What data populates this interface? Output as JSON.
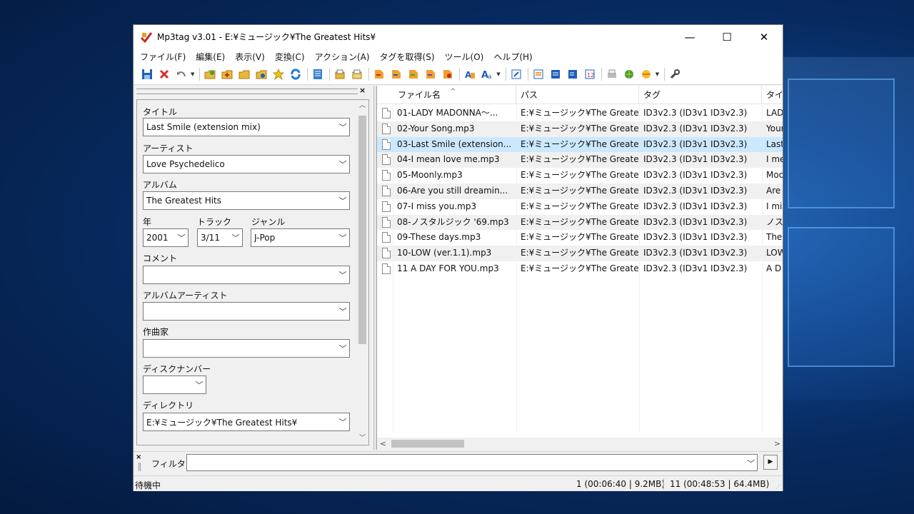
{
  "window": {
    "title": "Mp3tag v3.01  -  E:¥ミュージック¥The Greatest Hits¥",
    "minimize": "—",
    "maximize": "☐",
    "close": "✕"
  },
  "menu": [
    "ファイル(F)",
    "編集(E)",
    "表示(V)",
    "変換(C)",
    "アクション(A)",
    "タグを取得(S)",
    "ツール(O)",
    "ヘルプ(H)"
  ],
  "tag_panel": {
    "close": "×",
    "title": {
      "label": "タイトル",
      "value": "Last Smile (extension mix)"
    },
    "artist": {
      "label": "アーティスト",
      "value": "Love Psychedelico"
    },
    "album": {
      "label": "アルバム",
      "value": "The Greatest Hits"
    },
    "year": {
      "label": "年",
      "value": "2001"
    },
    "track": {
      "label": "トラック",
      "value": "3/11"
    },
    "genre": {
      "label": "ジャンル",
      "value": "J-Pop"
    },
    "comment": {
      "label": "コメント",
      "value": ""
    },
    "album_artist": {
      "label": "アルバムアーティスト",
      "value": ""
    },
    "composer": {
      "label": "作曲家",
      "value": ""
    },
    "disc_number": {
      "label": "ディスクナンバー",
      "value": ""
    },
    "directory": {
      "label": "ディレクトリ",
      "value": "E:¥ミュージック¥The Greatest Hits¥"
    }
  },
  "file_list": {
    "columns": [
      "ファイル名",
      "パス",
      "タグ",
      "タイ"
    ],
    "rows": [
      {
        "filename": "01-LADY MADONNA～...",
        "path": "E:¥ミュージック¥The Greate...",
        "tag": "ID3v2.3 (ID3v1 ID3v2.3)",
        "title": "LADY"
      },
      {
        "filename": "02-Your Song.mp3",
        "path": "E:¥ミュージック¥The Greate...",
        "tag": "ID3v2.3 (ID3v1 ID3v2.3)",
        "title": "Your"
      },
      {
        "filename": "03-Last Smile (extension...",
        "path": "E:¥ミュージック¥The Greate...",
        "tag": "ID3v2.3 (ID3v1 ID3v2.3)",
        "title": "Last"
      },
      {
        "filename": "04-I mean love me.mp3",
        "path": "E:¥ミュージック¥The Greate...",
        "tag": "ID3v2.3 (ID3v1 ID3v2.3)",
        "title": "I me"
      },
      {
        "filename": "05-Moonly.mp3",
        "path": "E:¥ミュージック¥The Greate...",
        "tag": "ID3v2.3 (ID3v1 ID3v2.3)",
        "title": "Moo"
      },
      {
        "filename": "06-Are you still dreamin...",
        "path": "E:¥ミュージック¥The Greate...",
        "tag": "ID3v2.3 (ID3v1 ID3v2.3)",
        "title": "Are"
      },
      {
        "filename": "07-I miss you.mp3",
        "path": "E:¥ミュージック¥The Greate...",
        "tag": "ID3v2.3 (ID3v1 ID3v2.3)",
        "title": "I mi"
      },
      {
        "filename": "08-ノスタルジック '69.mp3",
        "path": "E:¥ミュージック¥The Greate...",
        "tag": "ID3v2.3 (ID3v1 ID3v2.3)",
        "title": "ノスタ"
      },
      {
        "filename": "09-These days.mp3",
        "path": "E:¥ミュージック¥The Greate...",
        "tag": "ID3v2.3 (ID3v1 ID3v2.3)",
        "title": "The"
      },
      {
        "filename": "10-LOW (ver.1.1).mp3",
        "path": "E:¥ミュージック¥The Greate...",
        "tag": "ID3v2.3 (ID3v1 ID3v2.3)",
        "title": "LOW"
      },
      {
        "filename": "11 A DAY FOR YOU.mp3",
        "path": "E:¥ミュージック¥The Greate...",
        "tag": "ID3v2.3 (ID3v1 ID3v2.3)",
        "title": "A D"
      }
    ],
    "selected_row": "03-Last Smile (extension..."
  },
  "filter": {
    "label": "フィルタ:",
    "value": "",
    "go": "▶"
  },
  "status": {
    "left": "待機中",
    "selection": "1 (00:06:40 | 9.2MB)",
    "total": "11 (00:48:53 | 64.4MB)"
  },
  "colors": {
    "selection": "#cce8ff",
    "accent": "#0078d7"
  }
}
